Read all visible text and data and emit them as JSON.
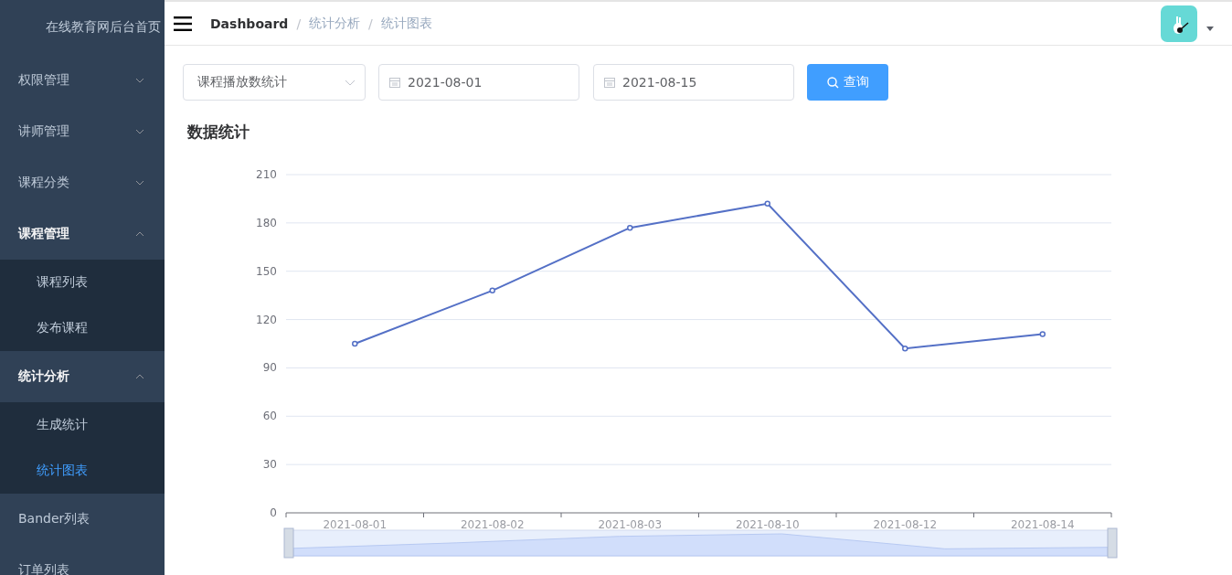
{
  "sidebar": {
    "title": "在线教育网后台首页",
    "items": [
      {
        "kind": "submenu",
        "label": "权限管理",
        "expanded": false
      },
      {
        "kind": "submenu",
        "label": "讲师管理",
        "expanded": false
      },
      {
        "kind": "submenu",
        "label": "课程分类",
        "expanded": false
      },
      {
        "kind": "submenu",
        "label": "课程管理",
        "expanded": true,
        "children": [
          {
            "label": "课程列表",
            "selected": false
          },
          {
            "label": "发布课程",
            "selected": false
          }
        ]
      },
      {
        "kind": "submenu",
        "label": "统计分析",
        "expanded": true,
        "children": [
          {
            "label": "生成统计",
            "selected": false
          },
          {
            "label": "统计图表",
            "selected": true
          }
        ]
      },
      {
        "kind": "item",
        "label": "Bander列表",
        "selected": false
      },
      {
        "kind": "item",
        "label": "订单列表",
        "selected": false
      }
    ]
  },
  "breadcrumb": [
    {
      "label": "Dashboard",
      "current": true
    },
    {
      "label": "统计分析",
      "current": false
    },
    {
      "label": "统计图表",
      "current": false
    }
  ],
  "breadcrumb_separator": "/",
  "filters": {
    "type_select": {
      "value": "课程播放数统计"
    },
    "start_date": {
      "value": "2021-08-01"
    },
    "end_date": {
      "value": "2021-08-15"
    },
    "query_button": "查询"
  },
  "section_title": "数据统计",
  "chart": {
    "chart_data": {
      "type": "line",
      "categories": [
        "2021-08-01",
        "2021-08-02",
        "2021-08-03",
        "2021-08-10",
        "2021-08-12",
        "2021-08-14"
      ],
      "series": [
        {
          "color": "#5470c6",
          "marker": true,
          "values": [
            105,
            138,
            177,
            192,
            102,
            111
          ]
        }
      ],
      "grid": true,
      "ylim": [
        0,
        210
      ],
      "yticks": [
        0,
        30,
        60,
        90,
        120,
        150,
        180,
        210
      ]
    }
  }
}
